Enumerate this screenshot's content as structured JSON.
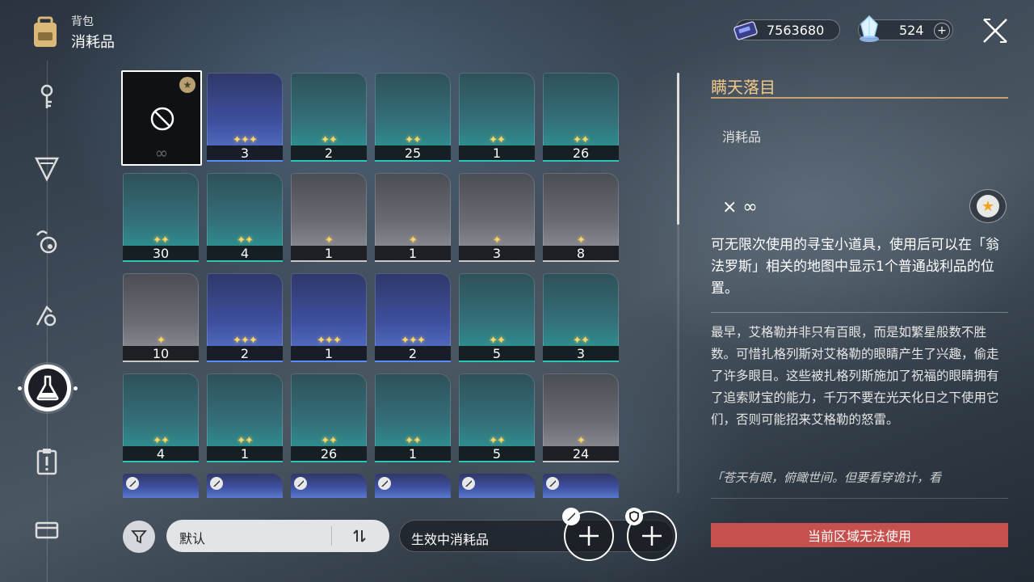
{
  "header": {
    "subtitle": "背包",
    "title": "消耗品"
  },
  "currency": {
    "credits": "7563680",
    "jade": "524",
    "plus": "+"
  },
  "grid": {
    "selected": {
      "qty": "∞"
    },
    "rows": [
      [
        {
          "rarity": "blue",
          "stars": "✦✦✦",
          "qty": "3"
        },
        {
          "rarity": "green",
          "stars": "✦✦",
          "qty": "2"
        },
        {
          "rarity": "green",
          "stars": "✦✦",
          "qty": "25"
        },
        {
          "rarity": "green",
          "stars": "✦✦",
          "qty": "1"
        },
        {
          "rarity": "green",
          "stars": "✦✦",
          "qty": "26"
        }
      ],
      [
        {
          "rarity": "green",
          "stars": "✦✦",
          "qty": "30"
        },
        {
          "rarity": "green",
          "stars": "✦✦",
          "qty": "4"
        },
        {
          "rarity": "gray",
          "stars": "✦",
          "qty": "1"
        },
        {
          "rarity": "gray",
          "stars": "✦",
          "qty": "1"
        },
        {
          "rarity": "gray",
          "stars": "✦",
          "qty": "3"
        },
        {
          "rarity": "gray",
          "stars": "✦",
          "qty": "8"
        }
      ],
      [
        {
          "rarity": "gray",
          "stars": "✦",
          "qty": "10"
        },
        {
          "rarity": "blue",
          "stars": "✦✦✦",
          "qty": "2"
        },
        {
          "rarity": "blue",
          "stars": "✦✦✦",
          "qty": "1"
        },
        {
          "rarity": "blue",
          "stars": "✦✦✦",
          "qty": "2"
        },
        {
          "rarity": "green",
          "stars": "✦✦",
          "qty": "5"
        },
        {
          "rarity": "green",
          "stars": "✦✦",
          "qty": "3"
        }
      ],
      [
        {
          "rarity": "green",
          "stars": "✦✦",
          "qty": "4"
        },
        {
          "rarity": "green",
          "stars": "✦✦",
          "qty": "1"
        },
        {
          "rarity": "green",
          "stars": "✦✦",
          "qty": "26"
        },
        {
          "rarity": "green",
          "stars": "✦✦",
          "qty": "1"
        },
        {
          "rarity": "green",
          "stars": "✦✦",
          "qty": "5"
        },
        {
          "rarity": "gray",
          "stars": "✦",
          "qty": "24"
        }
      ]
    ]
  },
  "controls": {
    "sort_label": "默认",
    "active_label": "生效中消耗品"
  },
  "detail": {
    "title": "瞒天落目",
    "category": "消耗品",
    "quantity": "× ∞",
    "description": "可无限次使用的寻宝小道具，使用后可以在「翁法罗斯」相关的地图中显示1个普通战利品的位置。",
    "lore": "最早，艾格勒并非只有百眼，而是如繁星般数不胜数。可惜扎格列斯对艾格勒的眼睛产生了兴趣，偷走了许多眼目。这些被扎格列斯施加了祝福的眼睛拥有了追索财宝的能力，千万不要在光天化日之下使用它们，否则可能招来艾格勒的怒雷。",
    "quote": "「苍天有眼，俯瞰世间。但要看穿诡计，看",
    "warning": "当前区域无法使用"
  },
  "colors": {
    "title_gold": "#f3c98a",
    "warning_red": "#c6504e",
    "star_gold": "#ffd866"
  }
}
